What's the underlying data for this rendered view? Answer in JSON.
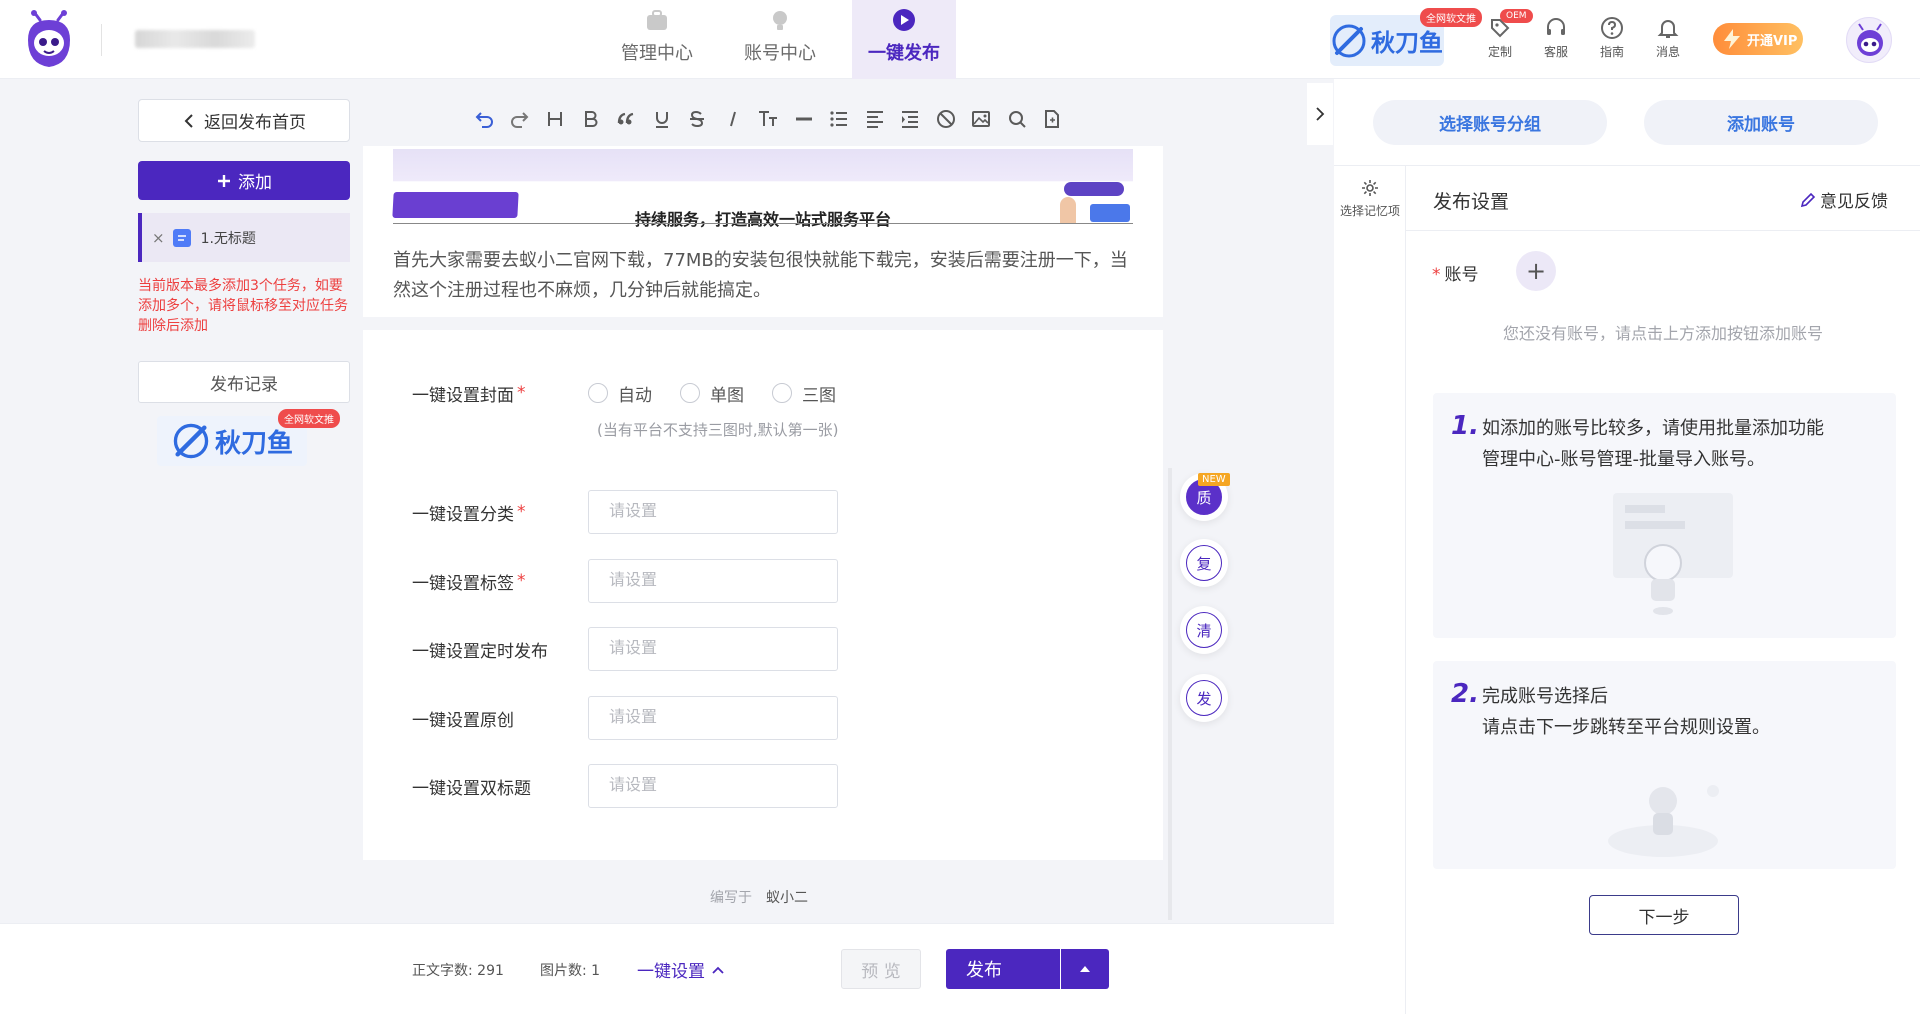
{
  "header": {
    "nav": [
      {
        "label": "管理中心",
        "icon": "briefcase-icon"
      },
      {
        "label": "账号中心",
        "icon": "bulb-icon"
      },
      {
        "label": "一键发布",
        "icon": "play-icon",
        "active": true
      }
    ],
    "brand_chip": {
      "name": "秋刀鱼",
      "badge": "全网软文推"
    },
    "tools": [
      {
        "label": "定制",
        "badge": "OEM",
        "icon": "tag-icon"
      },
      {
        "label": "客服",
        "icon": "headset-icon"
      },
      {
        "label": "指南",
        "icon": "help-icon"
      },
      {
        "label": "消息",
        "icon": "bell-icon"
      }
    ],
    "vip_label": "开通VIP"
  },
  "left": {
    "back_label": "返回发布首页",
    "add_label": "添加",
    "task_close": "×",
    "task_title": "1.无标题",
    "warning": "当前版本最多添加3个任务，如要添加多个，请将鼠标移至对应任务删除后添加",
    "record_label": "发布记录",
    "brand": {
      "name": "秋刀鱼",
      "badge": "全网软文推"
    }
  },
  "editor": {
    "toolbar_icons": [
      "undo-icon",
      "redo-icon",
      "heading-icon",
      "bold-icon",
      "quote-icon",
      "underline-icon",
      "strikethrough-icon",
      "italic-icon",
      "font-size-icon",
      "hr-icon",
      "list-icon",
      "align-icon",
      "indent-icon",
      "clear-format-icon",
      "image-icon",
      "search-icon",
      "doc-icon"
    ],
    "screenshot_heading": "持续服务，打造高效一站式服务平台",
    "paragraph": "首先大家需要去蚁小二官网下载，77MB的安装包很快就能下载完，安装后需要注册一下，当然这个注册过程也不麻烦，几分钟后就能搞定。"
  },
  "settings": {
    "cover": {
      "label": "一键设置封面",
      "options": [
        "自动",
        "单图",
        "三图"
      ],
      "hint": "(当有平台不支持三图时,默认第一张)"
    },
    "fields": [
      {
        "label": "一键设置分类",
        "required": "*",
        "placeholder": "请设置"
      },
      {
        "label": "一键设置标签",
        "required": "*",
        "placeholder": "请设置"
      },
      {
        "label": "一键设置定时发布",
        "required": "",
        "placeholder": "请设置"
      },
      {
        "label": "一键设置原创",
        "required": "",
        "placeholder": "请设置"
      },
      {
        "label": "一键设置双标题",
        "required": "",
        "placeholder": "请设置"
      }
    ],
    "author_label": "编写于",
    "author_name": "蚁小二"
  },
  "float_buttons": [
    {
      "char": "质",
      "tag": "NEW"
    },
    {
      "char": "复"
    },
    {
      "char": "清"
    },
    {
      "char": "发"
    }
  ],
  "footer": {
    "word_count_label": "正文字数:",
    "word_count": "291",
    "image_count_label": "图片数:",
    "image_count": "1",
    "one_click_label": "一键设置",
    "preview_label": "预 览",
    "publish_label": "发布"
  },
  "right": {
    "select_group_label": "选择账号分组",
    "add_account_label": "添加账号",
    "memo_label": "选择记忆项",
    "publish_settings_title": "发布设置",
    "feedback_label": "意见反馈",
    "account_label": "账号",
    "empty_text": "您还没有账号，请点击上方添加按钮添加账号",
    "tips": [
      {
        "num": "1.",
        "lines": [
          "如添加的账号比较多，请使用批量添加功能",
          "管理中心-账号管理-批量导入账号。"
        ]
      },
      {
        "num": "2.",
        "lines": [
          "完成账号选择后",
          "请点击下一步跳转至平台规则设置。"
        ]
      }
    ],
    "next_label": "下一步"
  },
  "colors": {
    "primary": "#4b27bf",
    "link_blue": "#3a76e0",
    "danger": "#ed4040"
  }
}
